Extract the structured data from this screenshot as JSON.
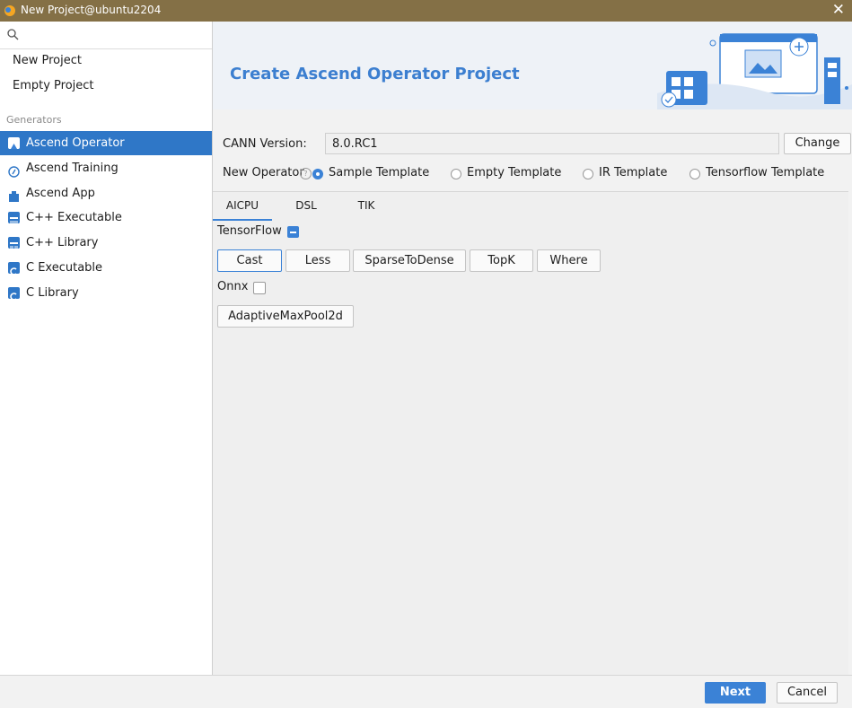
{
  "window": {
    "title": "New Project@ubuntu2204"
  },
  "sidebar": {
    "search_placeholder": "",
    "items": [
      {
        "label": "New Project"
      },
      {
        "label": "Empty Project"
      }
    ],
    "section_label": "Generators",
    "generators": [
      {
        "label": "Ascend Operator",
        "icon": "operator-icon",
        "color": "#3b82d6"
      },
      {
        "label": "Ascend Training",
        "icon": "training-icon",
        "color": "#2f77c7"
      },
      {
        "label": "Ascend App",
        "icon": "app-icon",
        "color": "#2f77c7"
      },
      {
        "label": "C++ Executable",
        "icon": "cpp-exe-icon",
        "color": "#2f77c7"
      },
      {
        "label": "C++ Library",
        "icon": "cpp-lib-icon",
        "color": "#2f77c7"
      },
      {
        "label": "C Executable",
        "icon": "c-exe-icon",
        "color": "#2f77c7"
      },
      {
        "label": "C Library",
        "icon": "c-lib-icon",
        "color": "#2f77c7"
      }
    ]
  },
  "main": {
    "title": "Create Ascend Operator Project",
    "cann_label": "CANN Version:",
    "cann_value": "8.0.RC1",
    "change_button": "Change",
    "new_operator_label": "New Operator",
    "help_glyph": "?",
    "templates": [
      {
        "label": "Sample Template",
        "selected": true
      },
      {
        "label": "Empty Template",
        "selected": false
      },
      {
        "label": "IR Template",
        "selected": false
      },
      {
        "label": "Tensorflow Template",
        "selected": false
      }
    ],
    "tabs": [
      {
        "label": "AICPU"
      },
      {
        "label": "DSL"
      },
      {
        "label": "TIK"
      }
    ],
    "tensorflow": {
      "label": "TensorFlow",
      "ops": [
        "Cast",
        "Less",
        "SparseToDense",
        "TopK",
        "Where"
      ]
    },
    "onnx": {
      "label": "Onnx",
      "ops": [
        "AdaptiveMaxPool2d"
      ]
    }
  },
  "footer": {
    "next_button": "Next",
    "cancel_button": "Cancel"
  },
  "accent_color": "#3b82d6"
}
